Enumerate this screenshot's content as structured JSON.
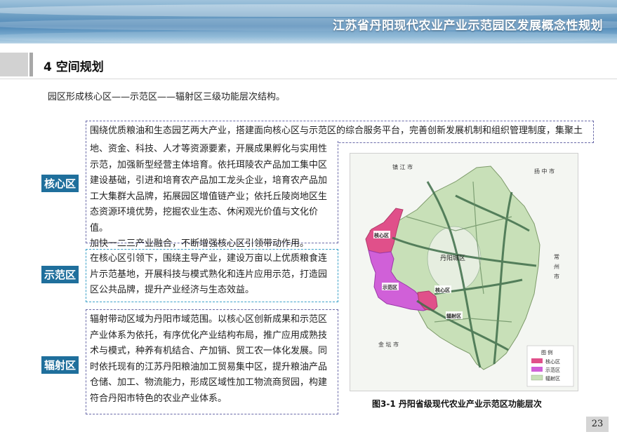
{
  "header": {
    "title": "江苏省丹阳现代农业产业示范园区发展概念性规划"
  },
  "section": {
    "title": "4  空间规划"
  },
  "intro": "园区形成核心区——示范区——辐射区三级功能层次结构。",
  "core": {
    "label": "核心区",
    "lines": [
      "围绕优质粮油和生态园艺两大产业，搭建面向核心区与示范区的综合服务平台，完善创新发展机制和组织管理制度，集聚土",
      "地、资金、科技、人才等资源要素，开展成果孵化与实用性",
      "示范，加强新型经营主体培育。依托珥陵农产品加工集中区",
      "建设基础，引进和培育农产品加工龙头企业，培育农产品加",
      "工大集群大品牌，拓展园区增值链产业；依托丘陵岗地区生",
      "态资源环境优势，挖掘农业生态、休闲观光价值与文化价值。",
      "加快一二三产业融合，不断增强核心区引领带动作用。"
    ]
  },
  "demo": {
    "label": "示范区",
    "lines": [
      "在核心区引领下，围绕主导产业，建设万亩以上优质粮食连",
      "片示范基地，开展科技与模式熟化和连片应用示范，打造园",
      "区公共品牌，提升产业经济与生态效益。"
    ]
  },
  "radiation": {
    "label": "辐射区",
    "lines": [
      "辐射带动区域为丹阳市域范围。以核心区创新成果和示范区",
      "产业体系为依托，有序优化产业结构布局，推广应用成熟技",
      "术与模式，种养有机结合、产加销、贸工农一体化发展。同",
      "时依托现有的江苏丹阳粮油加工贸易集中区，提升粮油产品",
      "仓储、加工、物流能力，形成区域性加工物流商贸园，构建",
      "符合丹阳市特色的农业产业体系。"
    ]
  },
  "map": {
    "labels": {
      "zhenjiang": "镇 江 市",
      "yangzhong": "扬 中 市",
      "changzhou": "常 州 市",
      "jintan": "金 坛 市",
      "danyang": "丹阳城区",
      "core1": "核心区",
      "core2": "核心区",
      "demo": "示范区",
      "radiation": "辐射区"
    },
    "legend": {
      "title": "图  例",
      "items": [
        {
          "label": "核心区",
          "color": "#e0508a"
        },
        {
          "label": "示范区",
          "color": "#d060d8"
        },
        {
          "label": "辐射区",
          "color": "#c8e0b8"
        }
      ]
    },
    "colors": {
      "core": "#e0508a",
      "demo": "#d060d8",
      "radiation": "#c8e0b8",
      "road": "#3f6e4a"
    }
  },
  "caption": "图3-1  丹阳省级现代农业产业示范区功能层次",
  "page_number": "23"
}
